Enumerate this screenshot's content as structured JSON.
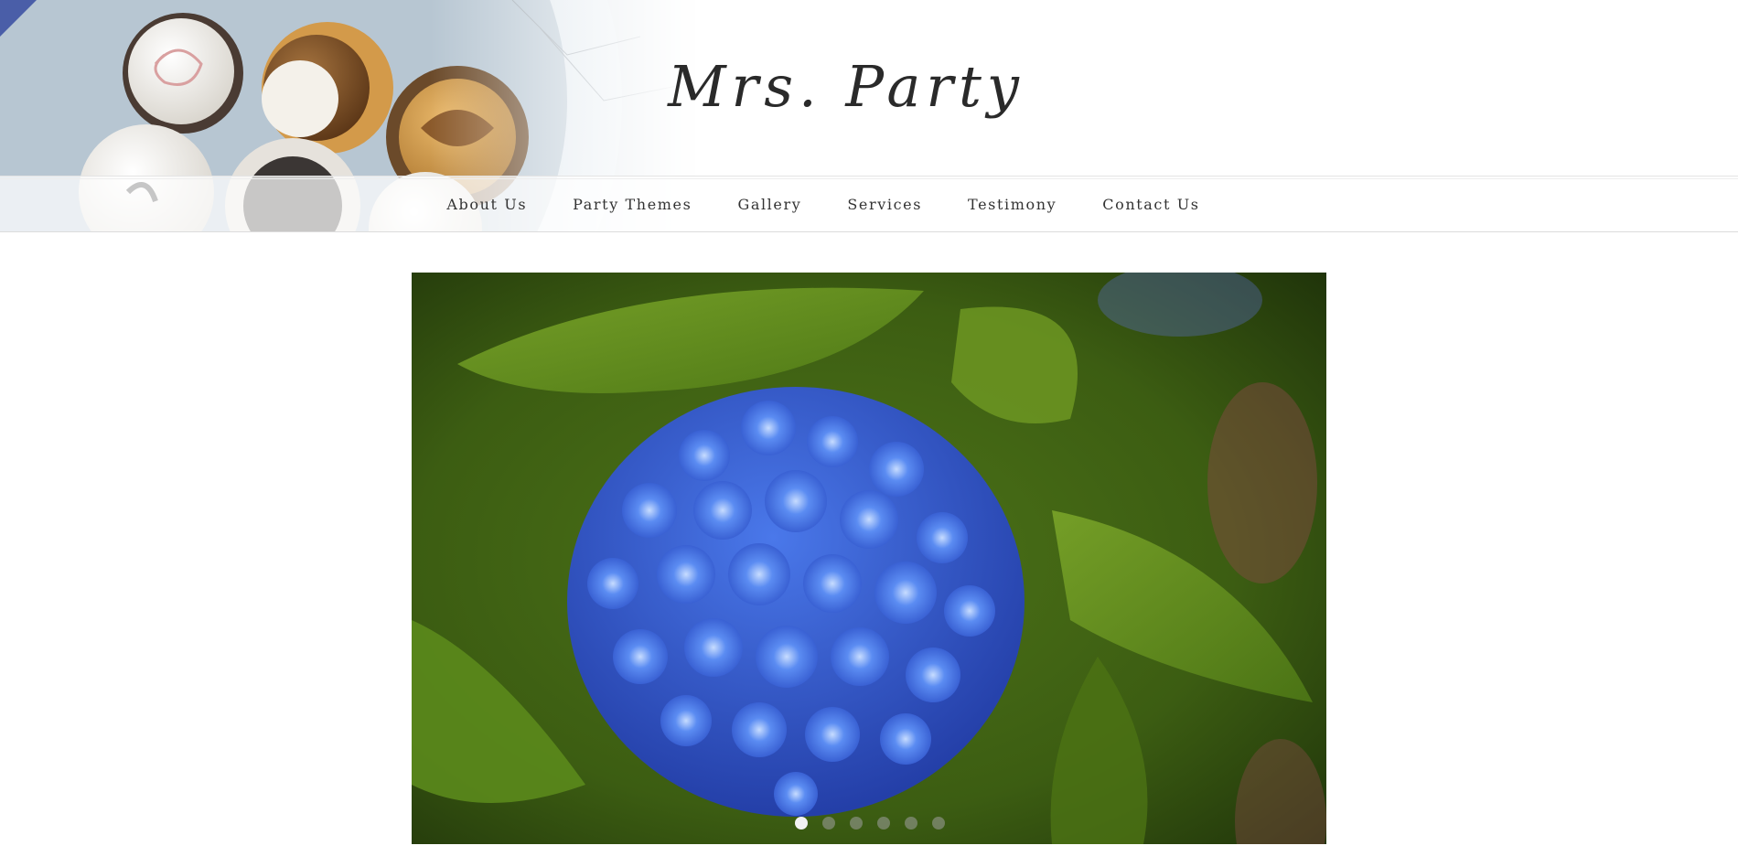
{
  "site": {
    "title": "Mrs. Party"
  },
  "nav": {
    "items": [
      {
        "label": "About Us"
      },
      {
        "label": "Party Themes"
      },
      {
        "label": "Gallery"
      },
      {
        "label": "Services"
      },
      {
        "label": "Testimony"
      },
      {
        "label": "Contact Us"
      }
    ]
  },
  "slider": {
    "slide_count": 6,
    "active_slide": 1
  },
  "colors": {
    "title_text": "#2a2a2a",
    "nav_text": "#333333",
    "leaf_green": "#5e8a1e",
    "hydrangea_blue": "#3f6fe0"
  },
  "icons": {
    "header_image": "cupcakes-photo",
    "slide_image": "blue-hydrangea-photo"
  }
}
